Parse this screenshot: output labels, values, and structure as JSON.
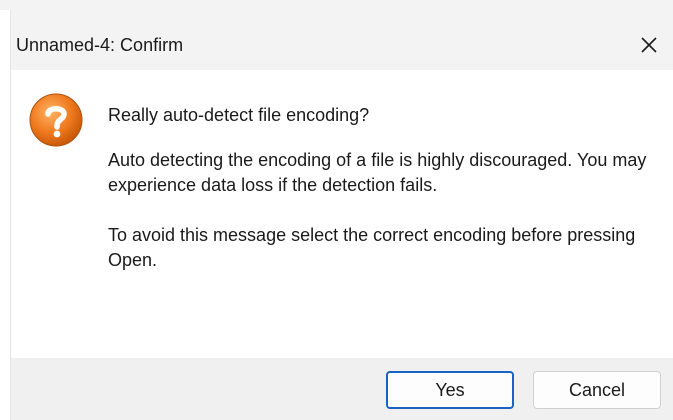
{
  "window": {
    "title": "Unnamed-4: Confirm",
    "close_icon": "close-icon"
  },
  "dialog": {
    "icon": "question-icon",
    "icon_color": "#f07a1e",
    "heading": "Really auto-detect file encoding?",
    "paragraph_1": "Auto detecting the encoding of a file is highly discouraged. You may experience data loss if the detection fails.",
    "paragraph_2": "To avoid this message select the correct encoding before pressing Open."
  },
  "buttons": {
    "yes_label": "Yes",
    "cancel_label": "Cancel",
    "default_accent": "#1a63c4"
  }
}
